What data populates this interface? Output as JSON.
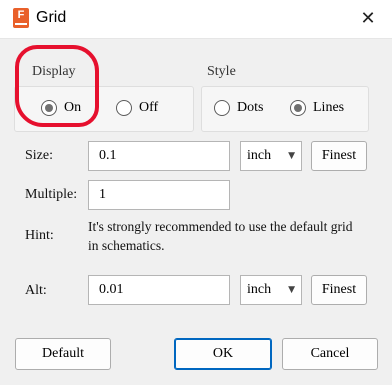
{
  "window": {
    "title": "Grid",
    "app_icon_letter": "F",
    "close_glyph": "✕"
  },
  "display": {
    "label": "Display",
    "options": [
      {
        "label": "On",
        "checked": true
      },
      {
        "label": "Off",
        "checked": false
      }
    ]
  },
  "style": {
    "label": "Style",
    "options": [
      {
        "label": "Dots",
        "checked": false
      },
      {
        "label": "Lines",
        "checked": true
      }
    ]
  },
  "size": {
    "label": "Size:",
    "value": "0.1",
    "unit": "inch",
    "finest_label": "Finest"
  },
  "multiple": {
    "label": "Multiple:",
    "value": "1"
  },
  "hint": {
    "label": "Hint:",
    "text_line1": "It's strongly recommended to use the default grid",
    "text_line2": "in schematics."
  },
  "alt": {
    "label": "Alt:",
    "value": "0.01",
    "unit": "inch",
    "finest_label": "Finest"
  },
  "buttons": {
    "default_label": "Default",
    "ok_label": "OK",
    "cancel_label": "Cancel"
  },
  "colors": {
    "annotation": "#e6102e",
    "accent": "#0067c0",
    "app_icon": "#e9602a"
  },
  "icons": {
    "app": "app-icon",
    "close": "close-icon",
    "dropdown": "chevron-down-icon"
  }
}
